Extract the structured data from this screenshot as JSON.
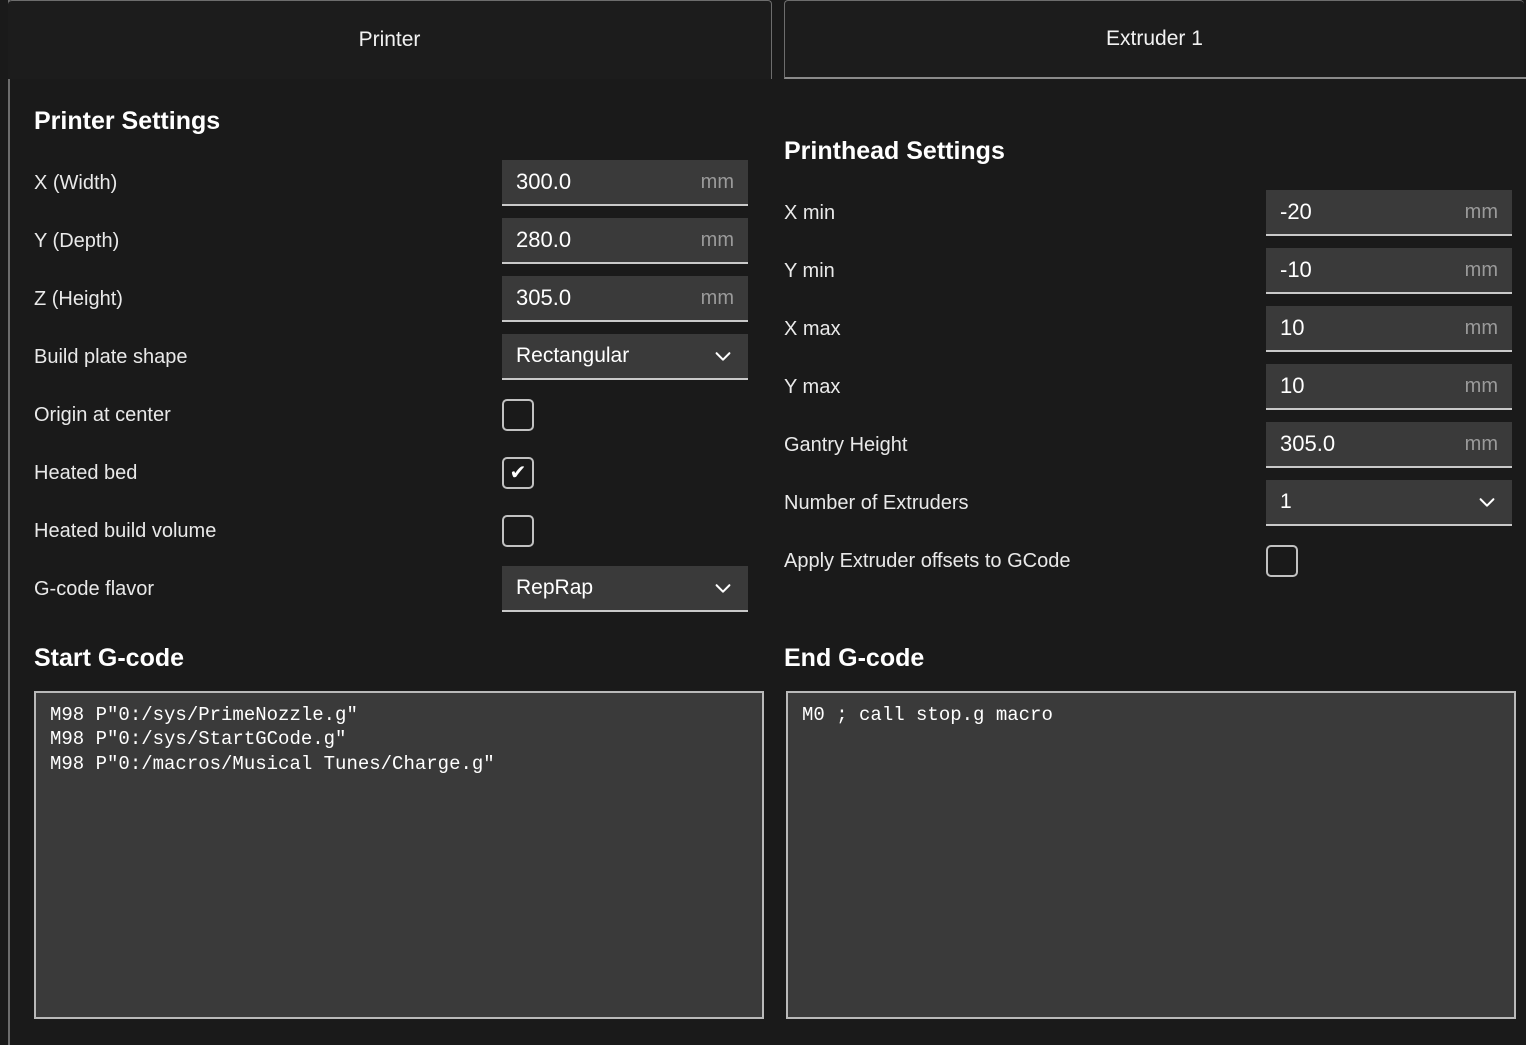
{
  "tabs": [
    {
      "label": "Printer",
      "active": true
    },
    {
      "label": "Extruder 1",
      "active": false
    }
  ],
  "printer_settings": {
    "heading": "Printer Settings",
    "rows": [
      {
        "label": "X (Width)",
        "type": "field",
        "value": "300.0",
        "unit": "mm"
      },
      {
        "label": "Y (Depth)",
        "type": "field",
        "value": "280.0",
        "unit": "mm"
      },
      {
        "label": "Z (Height)",
        "type": "field",
        "value": "305.0",
        "unit": "mm"
      },
      {
        "label": "Build plate shape",
        "type": "select",
        "value": "Rectangular"
      },
      {
        "label": "Origin at center",
        "type": "checkbox",
        "checked": false
      },
      {
        "label": "Heated bed",
        "type": "checkbox",
        "checked": true
      },
      {
        "label": "Heated build volume",
        "type": "checkbox",
        "checked": false
      },
      {
        "label": "G-code flavor",
        "type": "select",
        "value": "RepRap"
      }
    ]
  },
  "printhead_settings": {
    "heading": "Printhead Settings",
    "rows": [
      {
        "label": "X min",
        "type": "field",
        "value": "-20",
        "unit": "mm"
      },
      {
        "label": "Y min",
        "type": "field",
        "value": "-10",
        "unit": "mm"
      },
      {
        "label": "X max",
        "type": "field",
        "value": "10",
        "unit": "mm"
      },
      {
        "label": "Y max",
        "type": "field",
        "value": "10",
        "unit": "mm"
      },
      {
        "label": "Gantry Height",
        "type": "field",
        "value": "305.0",
        "unit": "mm"
      },
      {
        "label": "Number of Extruders",
        "type": "select",
        "value": "1"
      },
      {
        "label": "Apply Extruder offsets to GCode",
        "type": "checkbox",
        "checked": false
      }
    ]
  },
  "start_gcode": {
    "title": "Start G-code",
    "text": "M98 P\"0:/sys/PrimeNozzle.g\"\nM98 P\"0:/sys/StartGCode.g\"\nM98 P\"0:/macros/Musical Tunes/Charge.g\""
  },
  "end_gcode": {
    "title": "End G-code",
    "text": "M0 ; call stop.g macro"
  },
  "icons": {
    "chevron_down": "chevron-down-icon",
    "check": "✔"
  },
  "colors": {
    "page_bg": "#1a1a1a",
    "field_bg": "#3a3a3a",
    "border": "#c1c1c1",
    "text": "#ffffff",
    "unit_text": "#9a9a9a"
  }
}
